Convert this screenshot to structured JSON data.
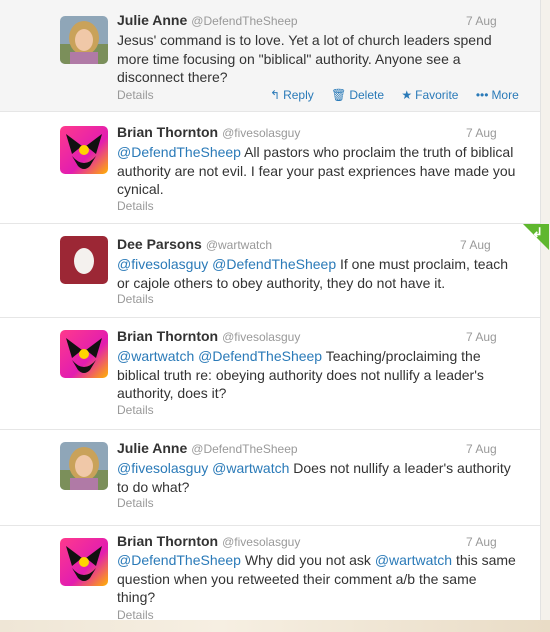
{
  "tweets": [
    {
      "name": "Julie Anne",
      "handle": "@DefendTheSheep",
      "time": "7 Aug",
      "text": "Jesus' command is to love. Yet a lot of church leaders spend more time focusing on \"biblical\" authority.  Anyone see a disconnect there?",
      "details": "Details",
      "actions": {
        "reply": "Reply",
        "delete": "Delete",
        "favorite": "Favorite",
        "more": "More"
      }
    },
    {
      "name": "Brian Thornton",
      "handle": "@fivesolasguy",
      "time": "7 Aug",
      "mentions": "@DefendTheSheep",
      "text": "All pastors who proclaim the truth of biblical authority are not evil. I fear your past expriences have made you cynical.",
      "details": "Details"
    },
    {
      "name": "Dee Parsons",
      "handle": "@wartwatch",
      "time": "7 Aug",
      "mentions": "@fivesolasguy @DefendTheSheep",
      "text": "If one must proclaim, teach or cajole others to obey authority, they do not have it.",
      "details": "Details"
    },
    {
      "name": "Brian Thornton",
      "handle": "@fivesolasguy",
      "time": "7 Aug",
      "mentions": "@wartwatch @DefendTheSheep",
      "text": "Teaching/proclaiming the biblical truth re: obeying authority does not nullify a leader's authority, does it?",
      "details": "Details"
    },
    {
      "name": "Julie Anne",
      "handle": "@DefendTheSheep",
      "time": "7 Aug",
      "mentions": "@fivesolasguy @wartwatch",
      "text": "Does not nullify a leader's authority to do what?",
      "details": "Details"
    },
    {
      "name": "Brian Thornton",
      "handle": "@fivesolasguy",
      "time": "7 Aug",
      "mentions": "@DefendTheSheep",
      "text": "Why did you not ask",
      "mention2": "@wartwatch",
      "text2": "this same question when you retweeted their comment a/b the same thing?",
      "details": "Details"
    }
  ],
  "colors": {
    "link": "#2a7ab8",
    "muted": "#999999",
    "text": "#333333",
    "corner": "#5fb72f"
  }
}
